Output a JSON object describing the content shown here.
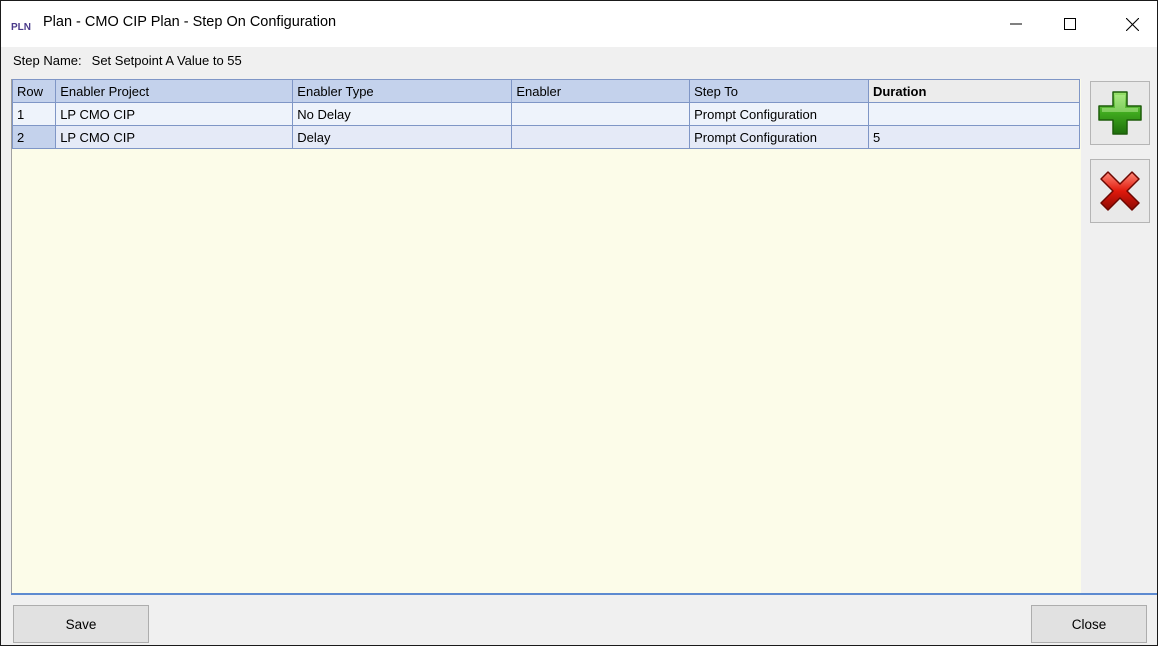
{
  "window": {
    "title": "Plan - CMO CIP Plan - Step On Configuration",
    "app_icon_text": "PLN",
    "controls": {
      "minimize": "—",
      "maximize": "☐",
      "close": "✕"
    }
  },
  "step": {
    "label": "Step Name:",
    "value": "Set Setpoint A Value to 55"
  },
  "grid": {
    "columns": [
      "Row",
      "Enabler Project",
      "Enabler Type",
      "Enabler",
      "Step To",
      "Duration"
    ],
    "rows": [
      {
        "row": "1",
        "enabler_project": "LP CMO CIP",
        "enabler_type": "No Delay",
        "enabler": "",
        "step_to": "Prompt Configuration",
        "duration": ""
      },
      {
        "row": "2",
        "enabler_project": "LP CMO CIP",
        "enabler_type": "Delay",
        "enabler": "",
        "step_to": "Prompt Configuration",
        "duration": "5"
      }
    ]
  },
  "toolbar": {
    "add_icon": "green-plus-icon",
    "delete_icon": "red-x-icon"
  },
  "footer": {
    "save_label": "Save",
    "close_label": "Close"
  },
  "colors": {
    "header_bg": "#c4d2ec",
    "grid_bg": "#fcfce9",
    "row_bg": "#e5eaf7",
    "grid_border": "#7f96c6",
    "accent_line": "#5d8ad0"
  }
}
